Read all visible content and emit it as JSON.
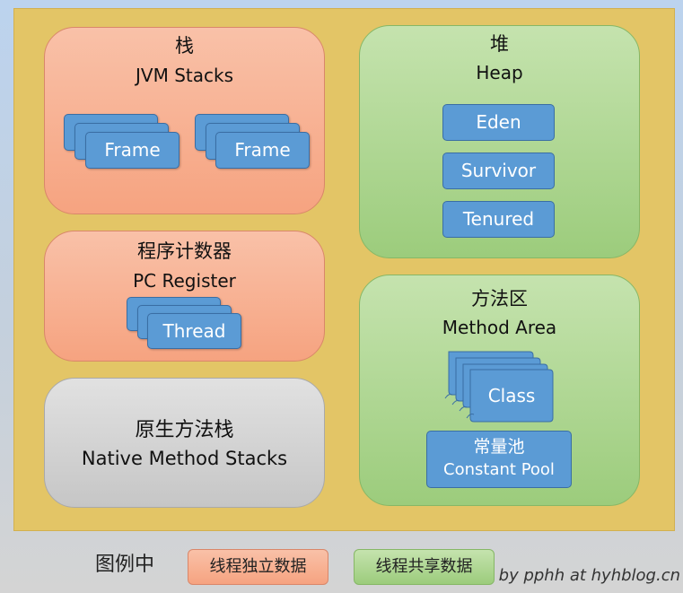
{
  "jvm_stacks": {
    "title_cn": "栈",
    "title_en": "JVM Stacks",
    "frame_label": "Frame"
  },
  "pc_register": {
    "title_cn": "程序计数器",
    "title_en": "PC Register",
    "thread_label": "Thread"
  },
  "native_stacks": {
    "title_cn": "原生方法栈",
    "title_en": "Native Method Stacks"
  },
  "heap": {
    "title_cn": "堆",
    "title_en": "Heap",
    "generations": [
      "Eden",
      "Survivor",
      "Tenured"
    ]
  },
  "method_area": {
    "title_cn": "方法区",
    "title_en": "Method Area",
    "class_label": "Class",
    "constant_pool_cn": "常量池",
    "constant_pool_en": "Constant Pool"
  },
  "legend": {
    "title": "图例中",
    "private_label": "线程独立数据",
    "shared_label": "线程共享数据"
  },
  "credit": "by pphh at hyhblog.cn",
  "colors": {
    "private_region": "#f6a380",
    "shared_region": "#9ccc7c",
    "native_region": "#c6c6c6",
    "box_blue": "#5b9bd5",
    "frame_bg": "#e3c566"
  }
}
